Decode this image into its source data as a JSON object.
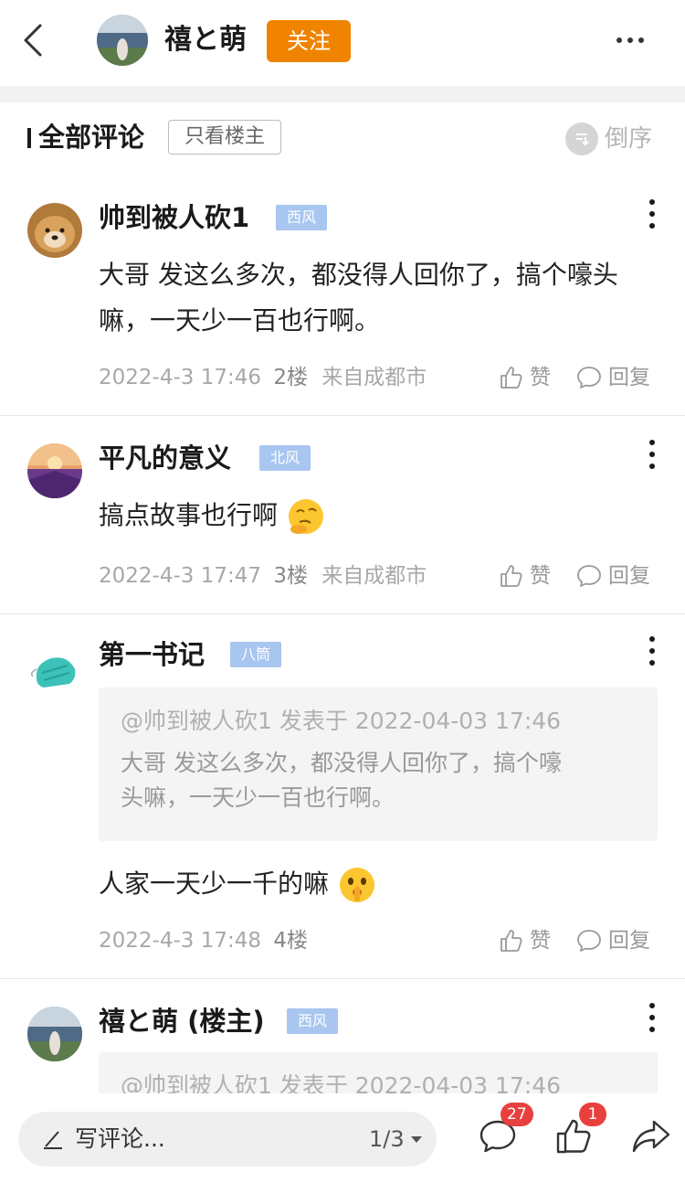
{
  "header": {
    "author_name": "禧と萌",
    "follow_label": "关注",
    "back_icon": "chevron-left-icon",
    "more_icon": "more-horizontal-icon"
  },
  "section": {
    "title": "全部评论",
    "only_owner_label": "只看楼主",
    "sort_label": "倒序"
  },
  "comments": [
    {
      "name": "帅到被人砍1",
      "badge": "西风",
      "text": "大哥 发这么多次，都没得人回你了，搞个嚎头嘛，一天少一百也行啊。",
      "date": "2022-4-3 17:46",
      "floor": "2楼",
      "location": "来自成都市",
      "like_label": "赞",
      "reply_label": "回复"
    },
    {
      "name": "平凡的意义",
      "badge": "北风",
      "text": "搞点故事也行啊",
      "emoji": "thinking-face-emoji",
      "date": "2022-4-3 17:47",
      "floor": "3楼",
      "location": "来自成都市",
      "like_label": "赞",
      "reply_label": "回复"
    },
    {
      "name": "第一书记",
      "badge": "八筒",
      "quote_head": "@帅到被人砍1 发表于 2022-04-03 17:46",
      "quote_body_line1": "大哥 发这么多次，都没得人回你了，搞个嚎",
      "quote_body_line2": "头嘛，一天少一百也行啊。",
      "text": "人家一天少一千的嘛",
      "emoji": "shushing-face-emoji",
      "date": "2022-4-3 17:48",
      "floor": "4楼",
      "like_label": "赞",
      "reply_label": "回复"
    },
    {
      "name": "禧と萌 (楼主)",
      "badge": "西风",
      "quote_head": "@帅到被人砍1 发表于 2022-04-03 17:46"
    }
  ],
  "bottom_bar": {
    "write_placeholder": "写评论...",
    "page_indicator": "1/3",
    "comment_count": "27",
    "like_count": "1",
    "icons": [
      "pen-icon",
      "comment-icon",
      "thumbs-up-icon",
      "share-icon"
    ]
  },
  "colors": {
    "accent": "#f08300",
    "badge_bg": "#a8c6ef",
    "count_badge": "#e8403f"
  }
}
